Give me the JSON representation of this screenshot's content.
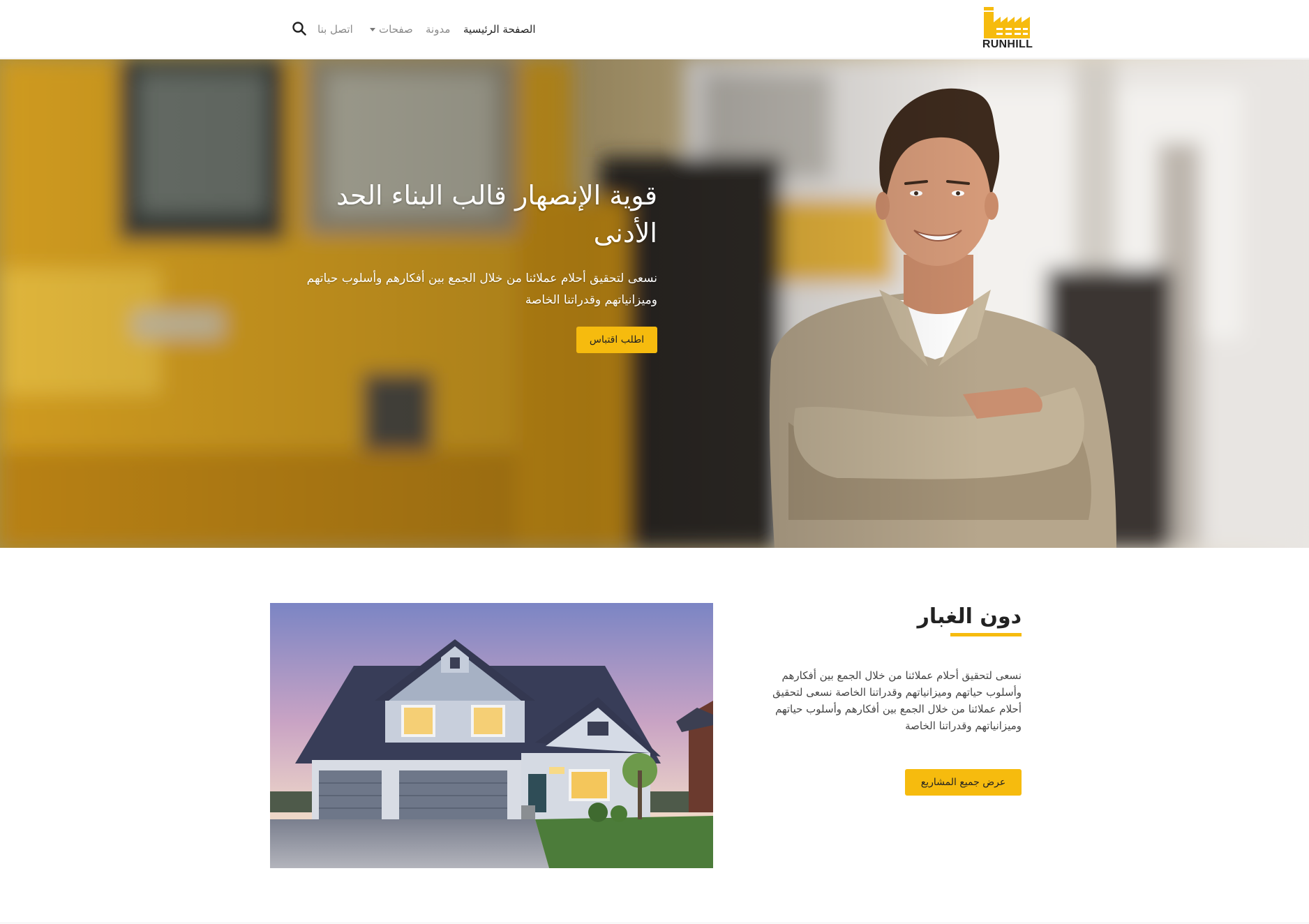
{
  "brand": {
    "logo_text": "RUNHILL",
    "accent_color": "#f6bb0e"
  },
  "nav": {
    "home": "الصفحة الرئيسية",
    "blog": "مدونة",
    "pages": "صفحات",
    "contact": "اتصل بنا",
    "search_icon": "search-icon"
  },
  "hero": {
    "title": "قوية الإنصهار قالب البناء الحد الأدنى",
    "subtitle": "نسعى لتحقيق أحلام عملائنا من خلال الجمع بين أفكارهم وأسلوب حياتهم وميزانياتهم وقدراتنا الخاصة",
    "button": "اطلب اقتباس"
  },
  "section": {
    "title": "دون الغبار",
    "text": "نسعى لتحقيق أحلام عملائنا من خلال الجمع بين أفكارهم وأسلوب حياتهم وميزانياتهم وقدراتنا الخاصة نسعى لتحقيق أحلام عملائنا من خلال الجمع بين أفكارهم وأسلوب حياتهم وميزانياتهم وقدراتنا الخاصة",
    "button": "عرض جميع المشاريع"
  }
}
